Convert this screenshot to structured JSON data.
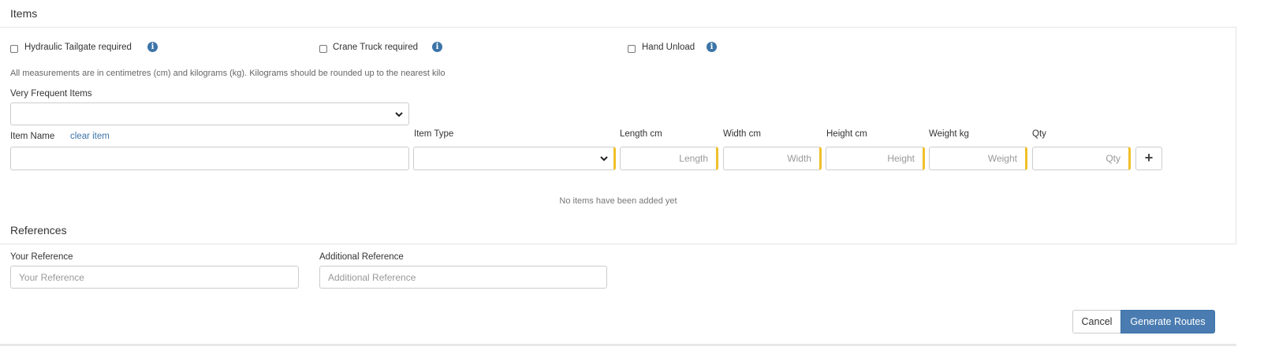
{
  "items_section": {
    "title": "Items",
    "checkboxes": [
      {
        "label": "Hydraulic Tailgate required",
        "checked": false
      },
      {
        "label": "Crane Truck required",
        "checked": false
      },
      {
        "label": "Hand Unload",
        "checked": false
      }
    ],
    "info_icon": "i",
    "measurement_note": "All measurements are in centimetres (cm) and kilograms (kg). Kilograms should be rounded up to the nearest kilo",
    "frequent_items_label": "Very Frequent Items",
    "frequent_items_value": "",
    "item_name_label": "Item Name",
    "clear_item_link": "clear item",
    "item_name_value": "",
    "item_type_label": "Item Type",
    "item_type_value": "",
    "length_label": "Length cm",
    "length_placeholder": "Length",
    "width_label": "Width cm",
    "width_placeholder": "Width",
    "height_label": "Height cm",
    "height_placeholder": "Height",
    "weight_label": "Weight kg",
    "weight_placeholder": "Weight",
    "qty_label": "Qty",
    "qty_placeholder": "Qty",
    "add_button_icon": "+",
    "empty_message": "No items have been added yet"
  },
  "references_section": {
    "title": "References",
    "your_reference_label": "Your Reference",
    "your_reference_placeholder": "Your Reference",
    "additional_reference_label": "Additional Reference",
    "additional_reference_placeholder": "Additional Reference"
  },
  "actions": {
    "cancel_label": "Cancel",
    "generate_label": "Generate Routes"
  },
  "colors": {
    "accent_blue": "#4a7cb1",
    "required_marker": "#f0c02a"
  },
  "icons": {
    "info": "info-circle-icon",
    "dropdown": "chevron-down-icon",
    "add": "plus-icon"
  }
}
